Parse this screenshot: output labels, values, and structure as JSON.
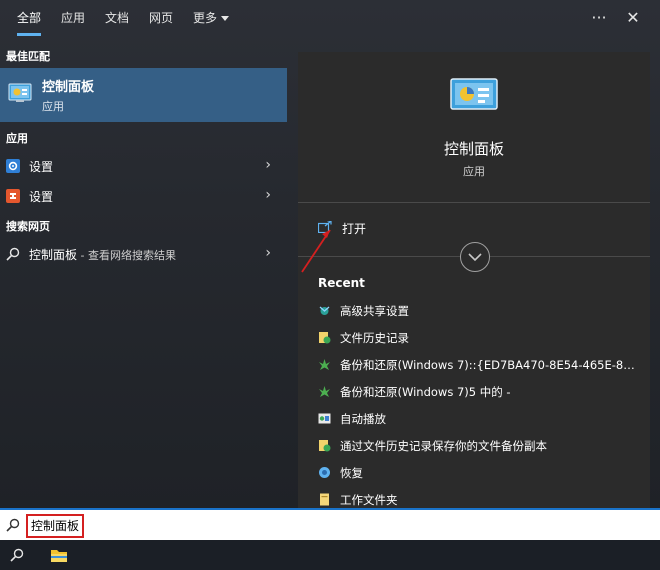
{
  "tabs": [
    {
      "label": "全部",
      "active": true
    },
    {
      "label": "应用"
    },
    {
      "label": "文档"
    },
    {
      "label": "网页"
    },
    {
      "label": "更多"
    }
  ],
  "top_actions": {
    "more_glyph": "···",
    "close_glyph": "✕"
  },
  "sections": {
    "best_match": "最佳匹配",
    "apps": "应用",
    "web": "搜索网页"
  },
  "best_match_item": {
    "title": "控制面板",
    "subtitle": "应用",
    "icon": "control-panel-icon"
  },
  "app_results": [
    {
      "label": "设置",
      "icon": "settings-gear-icon",
      "icon_color": "#2f7fd6"
    },
    {
      "label": "设置",
      "icon": "settings-app-icon",
      "icon_color": "#e4572e"
    }
  ],
  "web_result": {
    "label": "控制面板",
    "suffix": " - 查看网络搜索结果"
  },
  "detail": {
    "app_name": "控制面板",
    "app_type": "应用",
    "open_label": "打开",
    "recent_title": "Recent",
    "recent_items": [
      {
        "label": "高级共享设置",
        "icon": "network-sharing-icon"
      },
      {
        "label": "文件历史记录",
        "icon": "file-history-icon"
      },
      {
        "label": "备份和还原(Windows 7)::{ED7BA470-8E54-465E-825C...",
        "icon": "backup-restore-icon"
      },
      {
        "label": "备份和还原(Windows 7)5 中的 -",
        "icon": "backup-restore-icon"
      },
      {
        "label": "自动播放",
        "icon": "autoplay-icon"
      },
      {
        "label": "通过文件历史记录保存你的文件备份副本",
        "icon": "file-history-icon"
      },
      {
        "label": "恢复",
        "icon": "recovery-icon"
      },
      {
        "label": "工作文件夹",
        "icon": "work-folders-icon"
      }
    ]
  },
  "search": {
    "query": "控制面板"
  },
  "colors": {
    "accent": "#5fb2f0",
    "selection": "#355f86",
    "highlight_box": "#d42020",
    "annotation_arrow": "#d42020"
  }
}
